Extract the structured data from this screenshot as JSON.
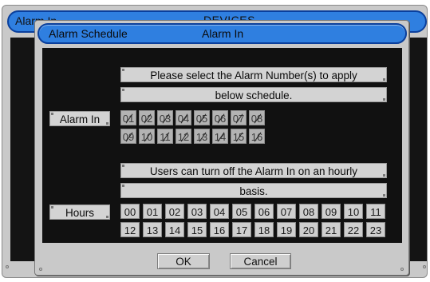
{
  "background_window": {
    "title_left": "Alarm In",
    "title_center": "DEVICES"
  },
  "dialog": {
    "title": "Alarm Schedule",
    "subtitle": "Alarm In",
    "instruction_1_line1": "Please select the Alarm Number(s) to apply",
    "instruction_1_line2": "below schedule.",
    "alarm_in_label": "Alarm In",
    "alarm_numbers": [
      "01",
      "02",
      "03",
      "04",
      "05",
      "06",
      "07",
      "08",
      "09",
      "10",
      "11",
      "12",
      "13",
      "14",
      "15",
      "16"
    ],
    "instruction_2_line1": "Users can turn off the Alarm In on an hourly",
    "instruction_2_line2": "basis.",
    "hours_label": "Hours",
    "hours": [
      "00",
      "01",
      "02",
      "03",
      "04",
      "05",
      "06",
      "07",
      "08",
      "09",
      "10",
      "11",
      "12",
      "13",
      "14",
      "15",
      "16",
      "17",
      "18",
      "19",
      "20",
      "21",
      "22",
      "23"
    ],
    "ok_label": "OK",
    "cancel_label": "Cancel"
  },
  "colors": {
    "title_bar": "#2f7fe0",
    "title_border": "#0a3f9c",
    "panel_bg": "#111111",
    "dialog_bg": "#c9c9c9"
  }
}
